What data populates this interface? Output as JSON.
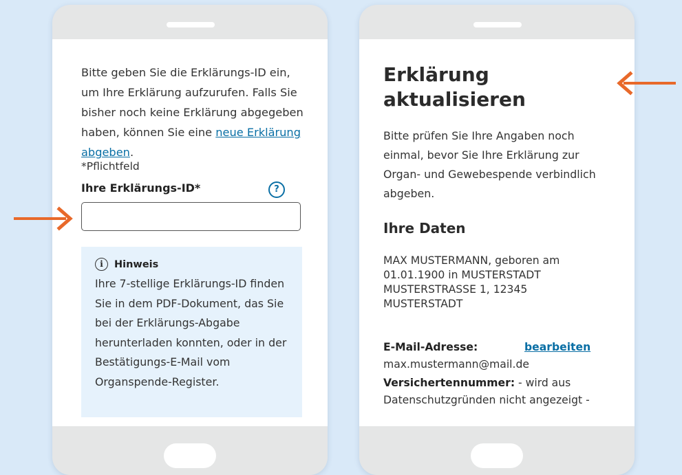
{
  "colors": {
    "background": "#d9e9f8",
    "accent_arrow": "#e8692a",
    "link": "#0a6fa5",
    "hint_box": "#e6f2fc"
  },
  "left_screen": {
    "intro": {
      "text": "Bitte geben Sie die Erklärungs-ID ein, um Ihre Erklärung aufzurufen. Falls Sie bisher noch keine Erklärung abgegeben haben, können Sie eine",
      "link": "neue Erklärung abgeben",
      "after_link": "."
    },
    "required_note": "*Pflichtfeld",
    "id_field": {
      "label": "Ihre Erklärungs-ID*",
      "value": "",
      "help_icon": "?"
    },
    "hint": {
      "icon": "i",
      "title": "Hinweis",
      "text": "Ihre 7-stellige Erklärungs-ID finden Sie in dem PDF-Dokument, das Sie bei der Erklärungs-Abgabe herunterladen konnten, oder in der Bestätigungs-E-Mail vom Organspende-Register."
    }
  },
  "right_screen": {
    "title": "Erklärung aktualisieren",
    "check_text": "Bitte prüfen Sie Ihre Angaben noch einmal, bevor Sie Ihre Erklärung zur Organ- und Gewebespende verbindlich abgeben.",
    "section_title": "Ihre Daten",
    "person": "MAX MUSTERMANN, geboren am 01.01.1900 in MUSTERSTADT MUSTERSTRASSE 1, 12345 MUSTERSTADT",
    "email_label": "E-Mail-Adresse:",
    "edit_link": "bearbeiten",
    "email_value": "max.mustermann@mail.de",
    "insurance_label": "Versichertennummer:",
    "insurance_value": " - wird aus Datenschutzgründen nicht angezeigt -"
  },
  "icons": [
    "arrow-right-icon",
    "arrow-left-icon",
    "help-icon",
    "info-icon"
  ]
}
